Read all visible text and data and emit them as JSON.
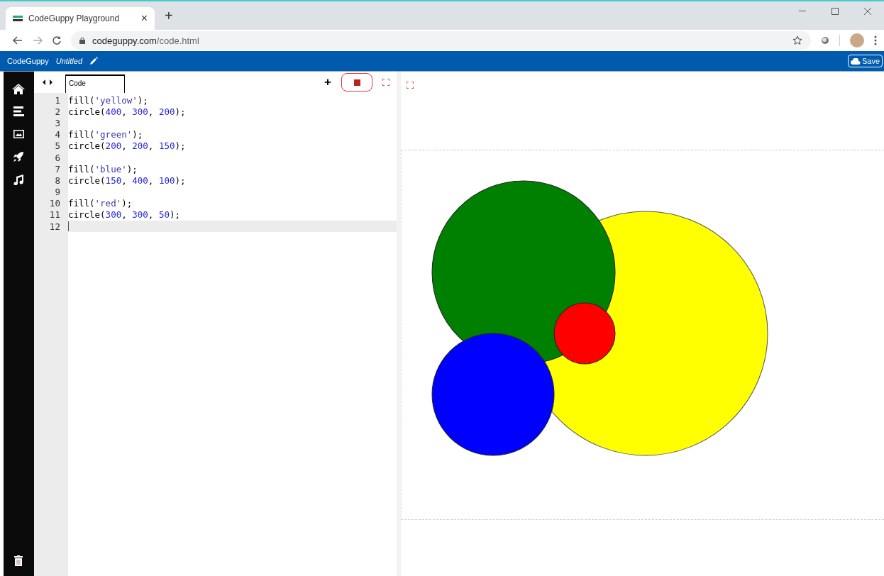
{
  "browser": {
    "tab_title": "CodeGuppy Playground",
    "tab_close": "×",
    "new_tab": "+",
    "url_host": "codeguppy.com",
    "url_path": "/code.html"
  },
  "app_bar": {
    "brand": "CodeGuppy",
    "project": "Untitled",
    "save": "Save"
  },
  "sidebar": {
    "items": [
      {
        "kind": "home"
      },
      {
        "kind": "list"
      },
      {
        "kind": "image"
      },
      {
        "kind": "rocket"
      },
      {
        "kind": "music"
      }
    ]
  },
  "editor": {
    "tab": "Code",
    "add": "+",
    "run_active": true,
    "lines": [
      {
        "number": "1",
        "segments": [
          {
            "text": "fill(",
            "kind": "plain"
          },
          {
            "text": "'yellow'",
            "kind": "str"
          },
          {
            "text": ");",
            "kind": "plain"
          }
        ]
      },
      {
        "number": "2",
        "segments": [
          {
            "text": "circle(",
            "kind": "plain"
          },
          {
            "text": "400",
            "kind": "num"
          },
          {
            "text": ", ",
            "kind": "plain"
          },
          {
            "text": "300",
            "kind": "num"
          },
          {
            "text": ", ",
            "kind": "plain"
          },
          {
            "text": "200",
            "kind": "num"
          },
          {
            "text": ");",
            "kind": "plain"
          }
        ]
      },
      {
        "number": "3"
      },
      {
        "number": "4",
        "segments": [
          {
            "text": "fill(",
            "kind": "plain"
          },
          {
            "text": "'green'",
            "kind": "str"
          },
          {
            "text": ");",
            "kind": "plain"
          }
        ]
      },
      {
        "number": "5",
        "segments": [
          {
            "text": "circle(",
            "kind": "plain"
          },
          {
            "text": "200",
            "kind": "num"
          },
          {
            "text": ", ",
            "kind": "plain"
          },
          {
            "text": "200",
            "kind": "num"
          },
          {
            "text": ", ",
            "kind": "plain"
          },
          {
            "text": "150",
            "kind": "num"
          },
          {
            "text": ");",
            "kind": "plain"
          }
        ]
      },
      {
        "number": "6"
      },
      {
        "number": "7",
        "segments": [
          {
            "text": "fill(",
            "kind": "plain"
          },
          {
            "text": "'blue'",
            "kind": "str"
          },
          {
            "text": ");",
            "kind": "plain"
          }
        ]
      },
      {
        "number": "8",
        "segments": [
          {
            "text": "circle(",
            "kind": "plain"
          },
          {
            "text": "150",
            "kind": "num"
          },
          {
            "text": ", ",
            "kind": "plain"
          },
          {
            "text": "400",
            "kind": "num"
          },
          {
            "text": ", ",
            "kind": "plain"
          },
          {
            "text": "100",
            "kind": "num"
          },
          {
            "text": ");",
            "kind": "plain"
          }
        ]
      },
      {
        "number": "9"
      },
      {
        "number": "10",
        "segments": [
          {
            "text": "fill(",
            "kind": "plain"
          },
          {
            "text": "'red'",
            "kind": "str"
          },
          {
            "text": ");",
            "kind": "plain"
          }
        ]
      },
      {
        "number": "11",
        "segments": [
          {
            "text": "circle(",
            "kind": "plain"
          },
          {
            "text": "300",
            "kind": "num"
          },
          {
            "text": ", ",
            "kind": "plain"
          },
          {
            "text": "300",
            "kind": "num"
          },
          {
            "text": ", ",
            "kind": "plain"
          },
          {
            "text": "50",
            "kind": "num"
          },
          {
            "text": ");",
            "kind": "plain"
          }
        ]
      },
      {
        "number": "12",
        "current": true
      }
    ]
  }
}
